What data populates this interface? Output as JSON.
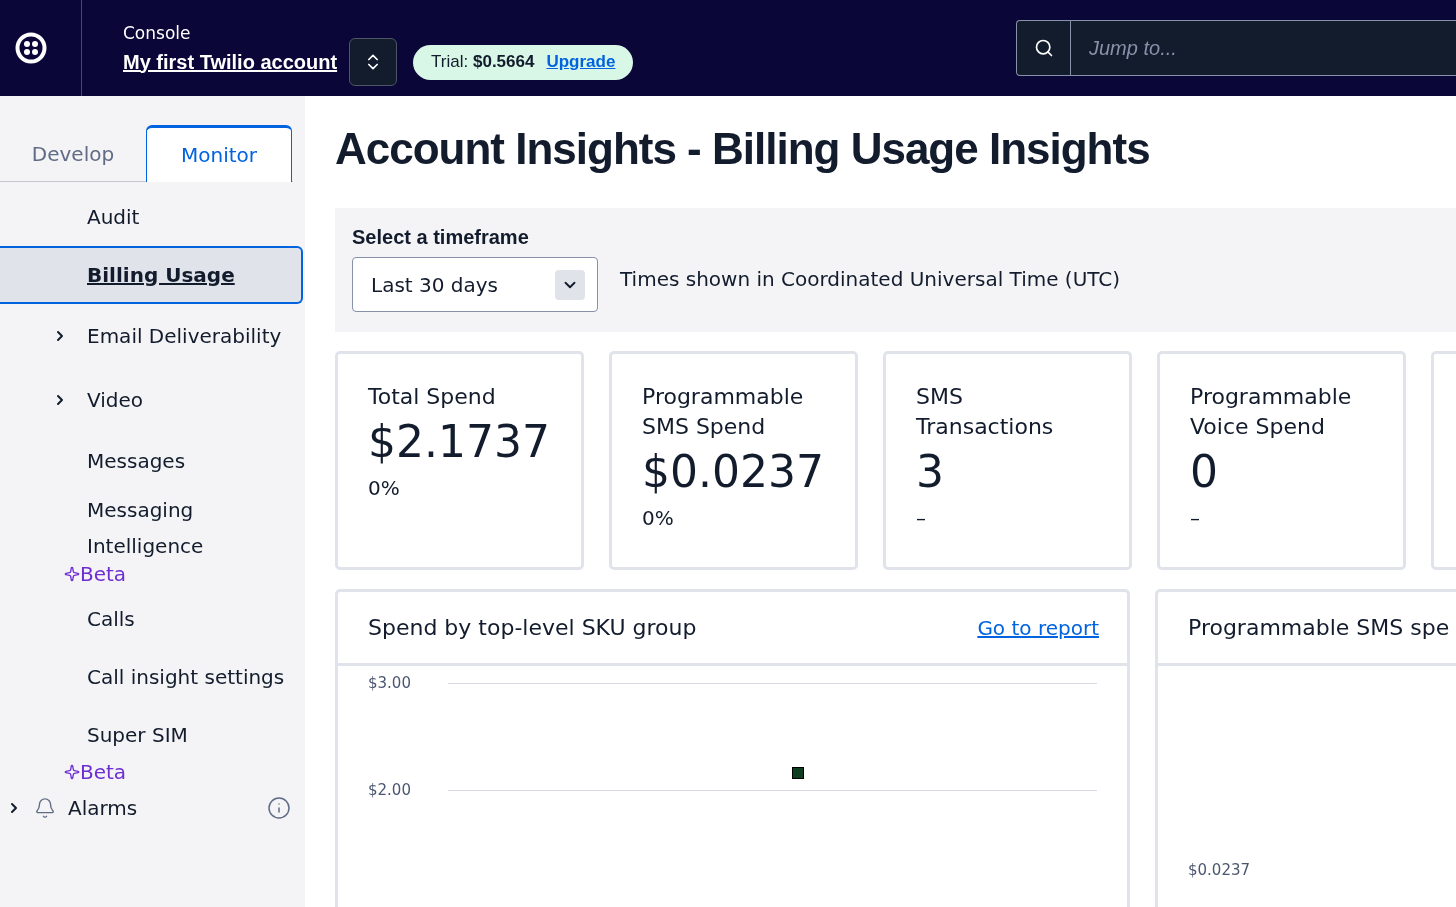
{
  "header": {
    "console_label": "Console",
    "account_name": "My first Twilio account",
    "trial": {
      "label": "Trial:",
      "amount": "$0.5664",
      "upgrade": "Upgrade"
    },
    "search": {
      "placeholder": "Jump to..."
    }
  },
  "sidebar": {
    "tabs": [
      {
        "label": "Develop",
        "selected": false
      },
      {
        "label": "Monitor",
        "selected": true
      }
    ],
    "items": [
      {
        "kind": "link",
        "label": "Audit",
        "selected": false
      },
      {
        "kind": "link",
        "label": "Billing Usage",
        "selected": true
      },
      {
        "kind": "group",
        "label": "Email Deliverability",
        "selected": false,
        "expanded": false
      },
      {
        "kind": "group",
        "label": "Video",
        "selected": false,
        "expanded": false
      },
      {
        "kind": "link",
        "label": "Messages",
        "selected": false
      },
      {
        "kind": "link",
        "label": "Messaging Intelligence",
        "selected": false,
        "badge": "Beta"
      },
      {
        "kind": "link",
        "label": "Calls",
        "selected": false
      },
      {
        "kind": "link",
        "label": "Call insight settings",
        "selected": false
      },
      {
        "kind": "link",
        "label": "Super SIM",
        "selected": false,
        "badge": "Beta"
      },
      {
        "kind": "alarm",
        "label": "Alarms",
        "selected": false,
        "expanded": false
      }
    ]
  },
  "page": {
    "title": "Account Insights - Billing Usage Insights",
    "timeframe": {
      "label": "Select a timeframe",
      "value": "Last 30 days",
      "note": "Times shown in Coordinated Universal Time (UTC)"
    },
    "stats": [
      {
        "title": "Total Spend",
        "value": "$2.1737",
        "change": "0%"
      },
      {
        "title": "Programmable SMS Spend",
        "value": "$0.0237",
        "change": "0%"
      },
      {
        "title": "SMS Transactions",
        "value": "3",
        "change": "–"
      },
      {
        "title": "Programmable Voice Spend",
        "value": "0",
        "change": "–"
      }
    ],
    "charts": [
      {
        "title": "Spend by top-level SKU group",
        "link": "Go to report",
        "chart_data": {
          "type": "scatter",
          "ylim": [
            2,
            3
          ],
          "yticks": [
            {
              "value": 2,
              "label": "$2.00"
            },
            {
              "value": 3,
              "label": "$3.00"
            }
          ],
          "series": [
            {
              "color": "#0f3d1f",
              "values": [
                2.17
              ]
            }
          ]
        }
      },
      {
        "title": "Programmable SMS spe",
        "axis_tick": "$0.0237"
      }
    ]
  }
}
